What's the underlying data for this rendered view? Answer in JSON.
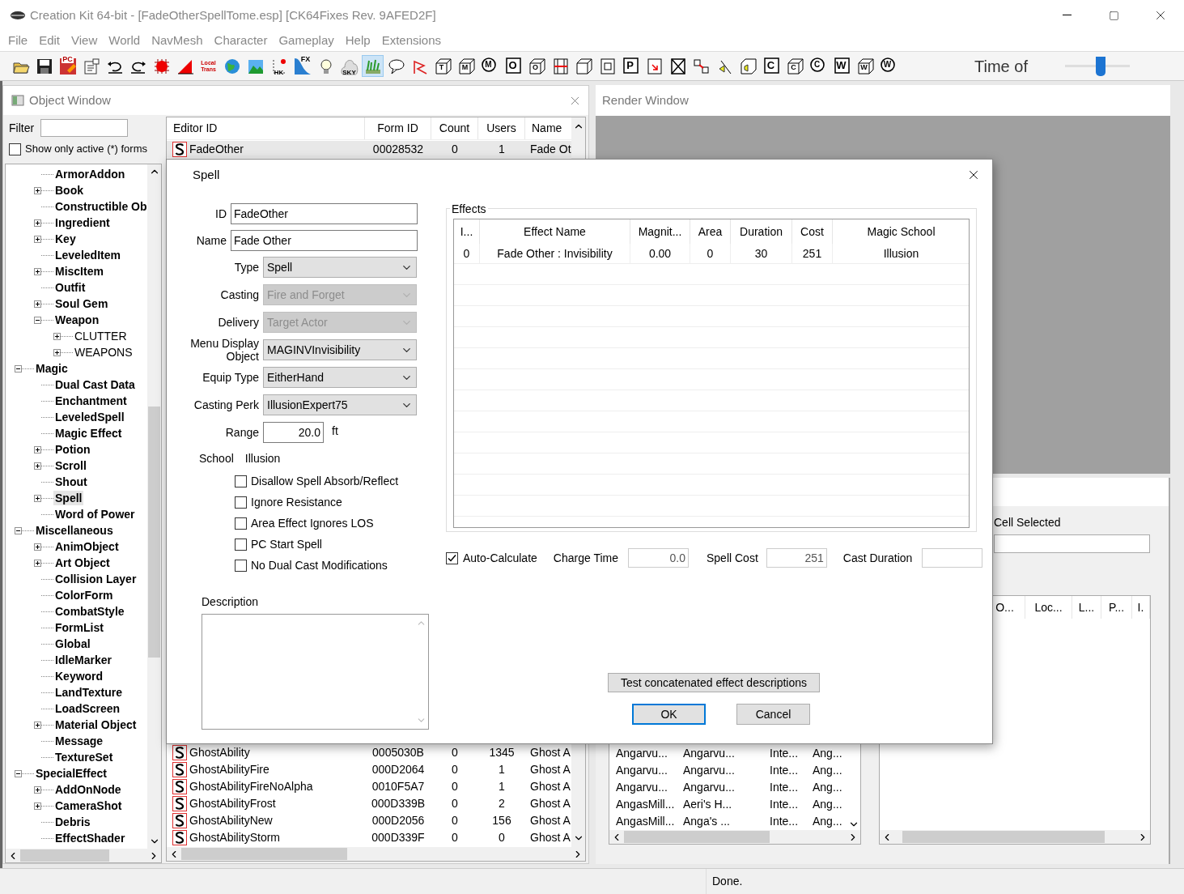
{
  "window": {
    "title": "Creation Kit 64-bit - [FadeOtherSpellTome.esp] [CK64Fixes Rev. 9AFED2F]"
  },
  "menu": [
    "File",
    "Edit",
    "View",
    "World",
    "NavMesh",
    "Character",
    "Gameplay",
    "Help",
    "Extensions"
  ],
  "toolbar": {
    "items": [
      {
        "kind": "folder",
        "selected": false
      },
      {
        "kind": "save",
        "selected": false
      },
      {
        "kind": "pc",
        "letter": "PC",
        "selected": false
      },
      {
        "kind": "doc",
        "selected": false
      },
      {
        "kind": "undo",
        "selected": false
      },
      {
        "kind": "redo",
        "selected": false
      },
      {
        "kind": "grid",
        "selected": false
      },
      {
        "kind": "angle",
        "selected": false
      },
      {
        "kind": "text",
        "letter": "Local Trans",
        "selected": false
      },
      {
        "kind": "globe",
        "selected": false
      },
      {
        "kind": "landscape",
        "selected": false
      },
      {
        "kind": "graph",
        "letter": "HK",
        "selected": false
      },
      {
        "kind": "water",
        "letter": "FX",
        "selected": false
      },
      {
        "kind": "bulb",
        "selected": false
      },
      {
        "kind": "sky",
        "letter": "SKY",
        "selected": false
      },
      {
        "kind": "grass",
        "selected": true
      },
      {
        "kind": "bubble",
        "selected": false
      },
      {
        "kind": "nav",
        "selected": false
      },
      {
        "kind": "cube",
        "letter": "T",
        "selected": false
      },
      {
        "kind": "cube",
        "letter": "M",
        "selected": false
      },
      {
        "kind": "circle",
        "letter": "M",
        "selected": false
      },
      {
        "kind": "box",
        "letter": "O",
        "selected": false
      },
      {
        "kind": "cube",
        "letter": "O",
        "selected": false
      },
      {
        "kind": "hbar",
        "selected": false
      },
      {
        "kind": "cube",
        "selected": false
      },
      {
        "kind": "frame",
        "selected": false
      },
      {
        "kind": "box",
        "letter": "P",
        "selected": false
      },
      {
        "kind": "arrowbox",
        "selected": false
      },
      {
        "kind": "xbox",
        "selected": false
      },
      {
        "kind": "link",
        "selected": false
      },
      {
        "kind": "light",
        "selected": false
      },
      {
        "kind": "speaker",
        "selected": false
      },
      {
        "kind": "box",
        "letter": "C",
        "selected": false
      },
      {
        "kind": "cube",
        "letter": "C",
        "selected": false
      },
      {
        "kind": "circle",
        "letter": "C",
        "selected": false
      },
      {
        "kind": "box",
        "letter": "W",
        "selected": false
      },
      {
        "kind": "cube",
        "letter": "W",
        "selected": false
      },
      {
        "kind": "circle",
        "letter": "W",
        "selected": false
      }
    ],
    "time_label": "Time of",
    "time_slider": {
      "level": 0.55
    }
  },
  "object_window": {
    "title": "Object Window",
    "filter": {
      "label": "Filter"
    },
    "active_only": {
      "label": "Show only active (*) forms",
      "checked": false
    },
    "tree": {
      "items_under_scrolled_parent": [
        {
          "label": "ArmorAddon",
          "selected": false
        },
        {
          "label": "Book",
          "expanded": false,
          "selected": false
        },
        {
          "label": "Constructible Ob",
          "selected": false
        },
        {
          "label": "Ingredient",
          "expanded": false,
          "selected": false
        },
        {
          "label": "Key",
          "expanded": false,
          "selected": false
        },
        {
          "label": "LeveledItem",
          "selected": false
        },
        {
          "label": "MiscItem",
          "expanded": false,
          "selected": false
        },
        {
          "label": "Outfit",
          "selected": false
        },
        {
          "label": "Soul Gem",
          "expanded": false,
          "selected": false
        },
        {
          "label": "Weapon",
          "expanded": true,
          "selected": false,
          "children": [
            {
              "label": "CLUTTER",
              "expanded": false,
              "selected": false
            },
            {
              "label": "WEAPONS",
              "expanded": false,
              "selected": false
            }
          ]
        }
      ],
      "items": [
        {
          "label": "Magic",
          "expanded": true,
          "selected": false,
          "children": [
            {
              "label": "Dual Cast Data",
              "selected": false
            },
            {
              "label": "Enchantment",
              "selected": false
            },
            {
              "label": "LeveledSpell",
              "selected": false
            },
            {
              "label": "Magic Effect",
              "selected": false
            },
            {
              "label": "Potion",
              "expanded": false,
              "selected": false
            },
            {
              "label": "Scroll",
              "expanded": false,
              "selected": false
            },
            {
              "label": "Shout",
              "selected": false
            },
            {
              "label": "Spell",
              "expanded": false,
              "selected": true
            },
            {
              "label": "Word of Power",
              "selected": false
            }
          ]
        },
        {
          "label": "Miscellaneous",
          "expanded": true,
          "selected": false,
          "children": [
            {
              "label": "AnimObject",
              "expanded": false,
              "selected": false
            },
            {
              "label": "Art Object",
              "expanded": false,
              "selected": false
            },
            {
              "label": "Collision Layer",
              "selected": false
            },
            {
              "label": "ColorForm",
              "selected": false
            },
            {
              "label": "CombatStyle",
              "selected": false
            },
            {
              "label": "FormList",
              "selected": false
            },
            {
              "label": "Global",
              "selected": false
            },
            {
              "label": "IdleMarker",
              "selected": false
            },
            {
              "label": "Keyword",
              "selected": false
            },
            {
              "label": "LandTexture",
              "selected": false
            },
            {
              "label": "LoadScreen",
              "selected": false
            },
            {
              "label": "Material Object",
              "expanded": false,
              "selected": false
            },
            {
              "label": "Message",
              "selected": false
            },
            {
              "label": "TextureSet",
              "selected": false
            }
          ]
        },
        {
          "label": "SpecialEffect",
          "expanded": true,
          "selected": false,
          "children": [
            {
              "label": "AddOnNode",
              "expanded": false,
              "selected": false
            },
            {
              "label": "CameraShot",
              "expanded": false,
              "selected": false
            },
            {
              "label": "Debris",
              "selected": false
            },
            {
              "label": "EffectShader",
              "selected": false
            }
          ]
        }
      ]
    },
    "list": {
      "columns": [
        "Editor ID",
        "Form ID",
        "Count",
        "Users",
        "Name"
      ],
      "top_rows": [
        {
          "cells": [
            "FadeOther",
            "00028532",
            "0",
            "1",
            "Fade Ot"
          ],
          "selected": true
        }
      ],
      "bottom_rows": [
        {
          "cells": [
            "GhostAbility",
            "0005030B",
            "0",
            "1345",
            "Ghost A"
          ],
          "selected": false
        },
        {
          "cells": [
            "GhostAbilityFire",
            "000D2064",
            "0",
            "1",
            "Ghost A"
          ],
          "selected": false
        },
        {
          "cells": [
            "GhostAbilityFireNoAlpha",
            "0010F5A7",
            "0",
            "1",
            "Ghost A"
          ],
          "selected": false
        },
        {
          "cells": [
            "GhostAbilityFrost",
            "000D339B",
            "0",
            "2",
            "Ghost A"
          ],
          "selected": false
        },
        {
          "cells": [
            "GhostAbilityNew",
            "000D2056",
            "0",
            "156",
            "Ghost A"
          ],
          "selected": false
        },
        {
          "cells": [
            "GhostAbilityStorm",
            "000D339F",
            "0",
            "0",
            "Ghost A"
          ],
          "selected": false
        }
      ]
    }
  },
  "render_window": {
    "title": "Render Window"
  },
  "cell_view": {
    "cell_label": "Cell Selected",
    "left_list": {
      "rows": [
        [
          "Angarvu...",
          "Angarvu...",
          "Inte...",
          "Ang..."
        ],
        [
          "Angarvu...",
          "Angarvu...",
          "Inte...",
          "Ang..."
        ],
        [
          "Angarvu...",
          "Angarvu...",
          "Inte...",
          "Ang..."
        ],
        [
          "AngasMill...",
          "Aeri's H...",
          "Inte...",
          "Ang..."
        ],
        [
          "AngasMill...",
          "Anga's ...",
          "Inte...",
          "Ang..."
        ]
      ]
    },
    "right_list": {
      "columns": [
        "O...",
        "Loc...",
        "L...",
        "P...",
        "I."
      ]
    }
  },
  "spell_dialog": {
    "title": "Spell",
    "fields": [
      {
        "kind": "text",
        "label": "ID",
        "value": "FadeOther"
      },
      {
        "kind": "text",
        "label": "Name",
        "value": "Fade Other"
      },
      {
        "kind": "combo",
        "label": "Type",
        "value": "Spell",
        "disabled": false
      },
      {
        "kind": "combo",
        "label": "Casting",
        "value": "Fire and Forget",
        "disabled": true
      },
      {
        "kind": "combo",
        "label": "Delivery",
        "value": "Target Actor",
        "disabled": true
      },
      {
        "kind": "combo",
        "label": "Menu Display Object",
        "value": "MAGINVInvisibility",
        "disabled": false
      },
      {
        "kind": "combo",
        "label": "Equip Type",
        "value": "EitherHand",
        "disabled": false
      },
      {
        "kind": "combo",
        "label": "Casting Perk",
        "value": "IllusionExpert75",
        "disabled": false
      },
      {
        "kind": "number",
        "label": "Range",
        "value": "20.0",
        "unit": "ft"
      }
    ],
    "school": {
      "label": "School",
      "value": "Illusion"
    },
    "flags": [
      {
        "label": "Disallow Spell Absorb/Reflect",
        "checked": false
      },
      {
        "label": "Ignore Resistance",
        "checked": false
      },
      {
        "label": "Area Effect Ignores LOS",
        "checked": false
      },
      {
        "label": "PC Start Spell",
        "checked": false
      },
      {
        "label": "No Dual Cast Modifications",
        "checked": false
      }
    ],
    "description": {
      "label": "Description"
    },
    "effects": {
      "title": "Effects",
      "columns": [
        "I...",
        "Effect Name",
        "Magnit...",
        "Area",
        "Duration",
        "Cost",
        "Magic School"
      ],
      "rows": [
        [
          "0",
          "Fade Other : Invisibility",
          "0.00",
          "0",
          "30",
          "251",
          "Illusion"
        ]
      ]
    },
    "auto_calculate": {
      "label": "Auto-Calculate",
      "checked": true
    },
    "charge_time": {
      "label": "Charge Time",
      "value": "0.0"
    },
    "spell_cost": {
      "label": "Spell Cost",
      "value": "251"
    },
    "cast_duration": {
      "label": "Cast Duration"
    },
    "buttons": {
      "test": "Test concatenated effect descriptions",
      "ok": "OK",
      "cancel": "Cancel"
    }
  },
  "status_bar": {
    "text": "Done."
  }
}
